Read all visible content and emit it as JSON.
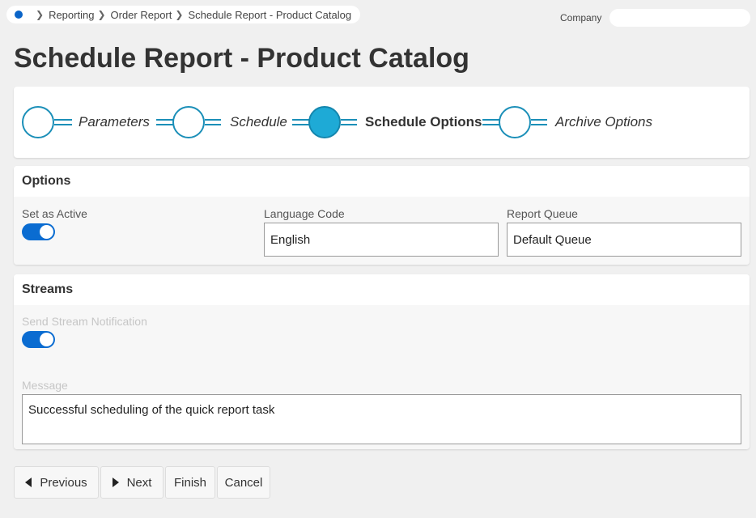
{
  "breadcrumb": {
    "items": [
      "Reporting",
      "Order Report",
      "Schedule Report - Product Catalog"
    ]
  },
  "header": {
    "company_label": "Company",
    "company_value": ""
  },
  "page": {
    "title": "Schedule Report - Product Catalog"
  },
  "stepper": {
    "steps": [
      {
        "label": "Parameters",
        "active": false
      },
      {
        "label": "Schedule",
        "active": false
      },
      {
        "label": "Schedule Options",
        "active": true
      },
      {
        "label": "Archive Options",
        "active": false
      }
    ],
    "accent_color": "#1eaad6"
  },
  "options": {
    "title": "Options",
    "set_active_label": "Set as Active",
    "set_active_on": true,
    "language_code_label": "Language Code",
    "language_code_value": "English",
    "report_queue_label": "Report Queue",
    "report_queue_value": "Default Queue"
  },
  "streams": {
    "title": "Streams",
    "send_notification_label": "Send Stream Notification",
    "send_notification_on": true,
    "message_label": "Message",
    "message_value": "Successful scheduling of the quick report task"
  },
  "actions": {
    "previous": "Previous",
    "next": "Next",
    "finish": "Finish",
    "cancel": "Cancel"
  },
  "colors": {
    "toggle_on": "#0a6cd1",
    "home_dot": "#0a64c8"
  }
}
